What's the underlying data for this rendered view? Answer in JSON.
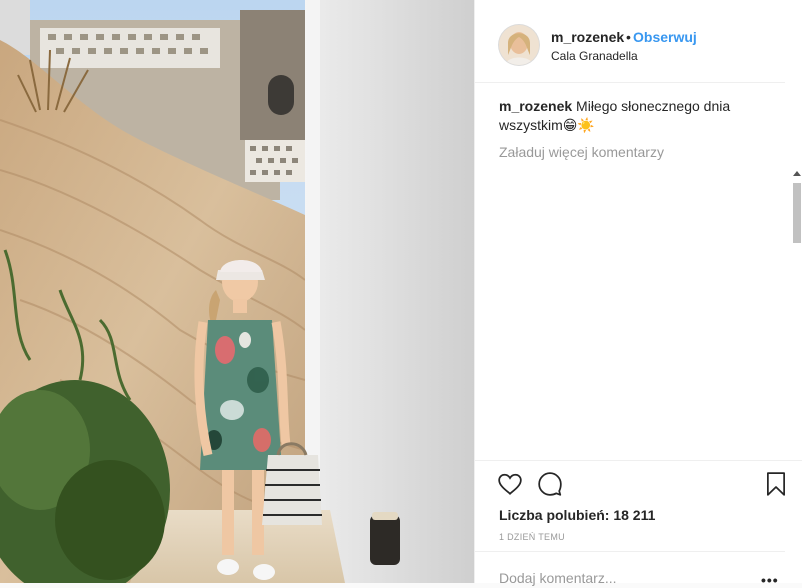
{
  "post": {
    "username": "m_rozenek",
    "separator": "•",
    "follow_label": "Obserwuj",
    "location": "Cala Granadella",
    "caption_user": "m_rozenek",
    "caption_text": " Miłego słonecznego dnia wszystkim😁☀️",
    "load_more_label": "Załaduj więcej komentarzy",
    "likes_label": "Liczba polubień: 18 211",
    "timestamp": "1 DZIEŃ TEMU",
    "comment_placeholder": "Dodaj komentarz...",
    "more_label": "•••"
  },
  "icons": {
    "like": "heart-icon",
    "comment": "comment-icon",
    "save": "bookmark-icon",
    "more": "more-options-icon"
  }
}
